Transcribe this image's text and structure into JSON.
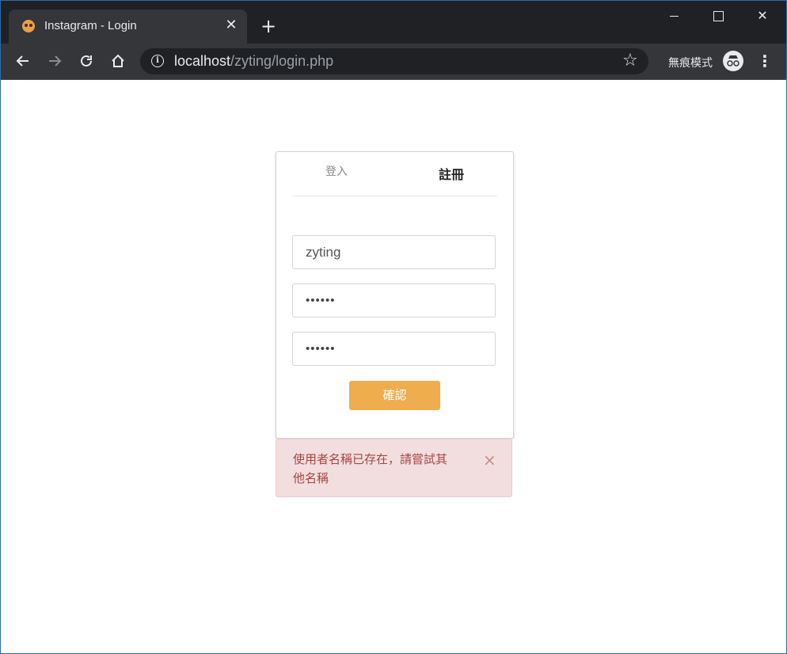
{
  "browser": {
    "tab_title": "Instagram - Login",
    "tab_close": "✕",
    "new_tab": "+",
    "url_host": "localhost",
    "url_path": "/zyting/login.php",
    "incognito_label": "無痕模式",
    "menu": "⋮"
  },
  "form": {
    "tabs": [
      {
        "label": "登入"
      },
      {
        "label": "註冊"
      }
    ],
    "username_value": "zyting",
    "password_value": "••••••",
    "confirm_password_value": "••••••",
    "submit_label": "確認"
  },
  "alert": {
    "message": "使用者名稱已存在，請嘗試其他名稱",
    "close": "×"
  }
}
